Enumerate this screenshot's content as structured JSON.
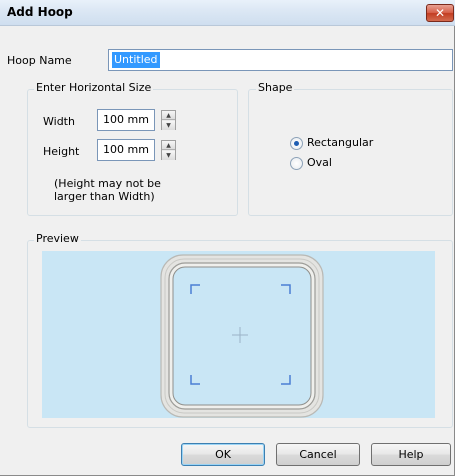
{
  "window": {
    "title": "Add Hoop",
    "close_glyph": "✕"
  },
  "hoop_name": {
    "label": "Hoop Name",
    "value": "Untitled"
  },
  "size_group": {
    "title": "Enter Horizontal Size",
    "width_label": "Width",
    "width_value": "100 mm",
    "height_label": "Height",
    "height_value": "100 mm",
    "note_line1": "(Height may not be",
    "note_line2": "larger than Width)"
  },
  "shape_group": {
    "title": "Shape",
    "options": [
      {
        "label": "Rectangular",
        "selected": true
      },
      {
        "label": "Oval",
        "selected": false
      }
    ]
  },
  "preview_group": {
    "title": "Preview"
  },
  "buttons": {
    "ok": "OK",
    "cancel": "Cancel",
    "help": "Help"
  },
  "colors": {
    "preview_bg": "#c9e6f5",
    "hoop_frame": "#e2e2df",
    "corner_marks": "#4a7fd4",
    "selection": "#3399ff"
  }
}
